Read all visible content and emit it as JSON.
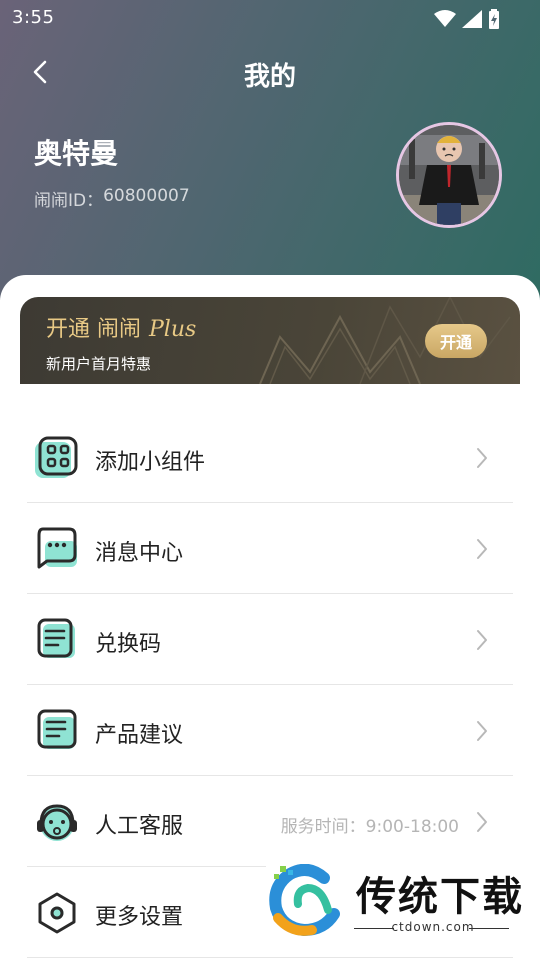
{
  "status_bar": {
    "time": "3:55"
  },
  "nav": {
    "title": "我的"
  },
  "profile": {
    "name": "奥特曼",
    "id_label": "闹闹ID：",
    "id_value": "60800007"
  },
  "vip": {
    "prefix": "开通 闹闹",
    "plus": "Plus",
    "subtitle": "新用户首月特惠",
    "button": "开通"
  },
  "menu": [
    {
      "label": "添加小组件",
      "icon": "widget-grid-icon"
    },
    {
      "label": "消息中心",
      "icon": "message-bubble-icon"
    },
    {
      "label": "兑换码",
      "icon": "redeem-code-icon"
    },
    {
      "label": "产品建议",
      "icon": "suggestion-note-icon"
    },
    {
      "label": "人工客服",
      "icon": "customer-service-icon",
      "extra": "服务时间：9:00-18:00"
    },
    {
      "label": "更多设置",
      "icon": "settings-hexagon-icon"
    }
  ],
  "watermark": {
    "text": "传统下载",
    "url": "ctdown.com"
  },
  "colors": {
    "accent": "#7ed9c8",
    "gold": "#e8c985",
    "header_start": "#6a6378",
    "header_end": "#2f6b62"
  }
}
